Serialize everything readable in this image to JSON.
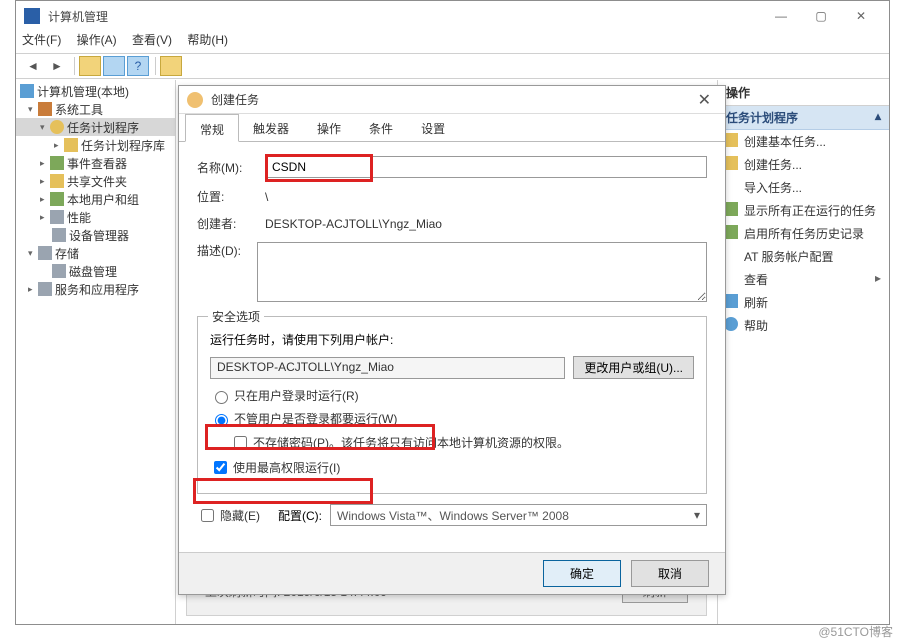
{
  "window": {
    "title": "计算机管理",
    "menus": [
      "文件(F)",
      "操作(A)",
      "查看(V)",
      "帮助(H)"
    ],
    "btn_min": "—",
    "btn_max": "▢",
    "btn_close": "✕"
  },
  "tree": {
    "root": "计算机管理(本地)",
    "sys_tools": "系统工具",
    "scheduler": "任务计划程序",
    "scheduler_lib": "任务计划程序库",
    "event_viewer": "事件查看器",
    "shared": "共享文件夹",
    "users": "本地用户和组",
    "perf": "性能",
    "devmgr": "设备管理器",
    "storage": "存储",
    "diskmgr": "磁盘管理",
    "services_apps": "服务和应用程序"
  },
  "actions": {
    "head": "操作",
    "section": "任务计划程序",
    "items": {
      "create_basic": "创建基本任务...",
      "create_task": "创建任务...",
      "import": "导入任务...",
      "show_running": "显示所有正在运行的任务",
      "enable_hist": "启用所有任务历史记录",
      "at_svc": "AT 服务帐户配置",
      "view": "查看",
      "refresh": "刷新",
      "help": "帮助"
    },
    "more_arrow": "▸"
  },
  "dialog": {
    "title": "创建任务",
    "close": "✕",
    "tabs": [
      "常规",
      "触发器",
      "操作",
      "条件",
      "设置"
    ],
    "labels": {
      "name": "名称(M):",
      "location": "位置:",
      "creator": "创建者:",
      "desc": "描述(D):"
    },
    "values": {
      "name": "CSDN",
      "location": "\\",
      "creator": "DESKTOP-ACJTOLL\\Yngz_Miao"
    },
    "security": {
      "legend": "安全选项",
      "run_as_label": "运行任务时，请使用下列用户帐户:",
      "user": "DESKTOP-ACJTOLL\\Yngz_Miao",
      "change_user_btn": "更改用户或组(U)...",
      "radio_logged_in": "只在用户登录时运行(R)",
      "radio_always": "不管用户是否登录都要运行(W)",
      "chk_no_pwd": "不存储密码(P)。该任务将只有访问本地计算机资源的权限。",
      "chk_highest": "使用最高权限运行(I)"
    },
    "hidden_label": "隐藏(E)",
    "config_label": "配置(C):",
    "config_value": "Windows Vista™、Windows Server™ 2008",
    "ok": "确定",
    "cancel": "取消",
    "dropdown_arrow": "▾"
  },
  "bottom": {
    "last_refresh": "上次刷新时间: 2019/6/15 14:44:09",
    "refresh_btn": "刷新"
  },
  "watermark": "@51CTO博客"
}
